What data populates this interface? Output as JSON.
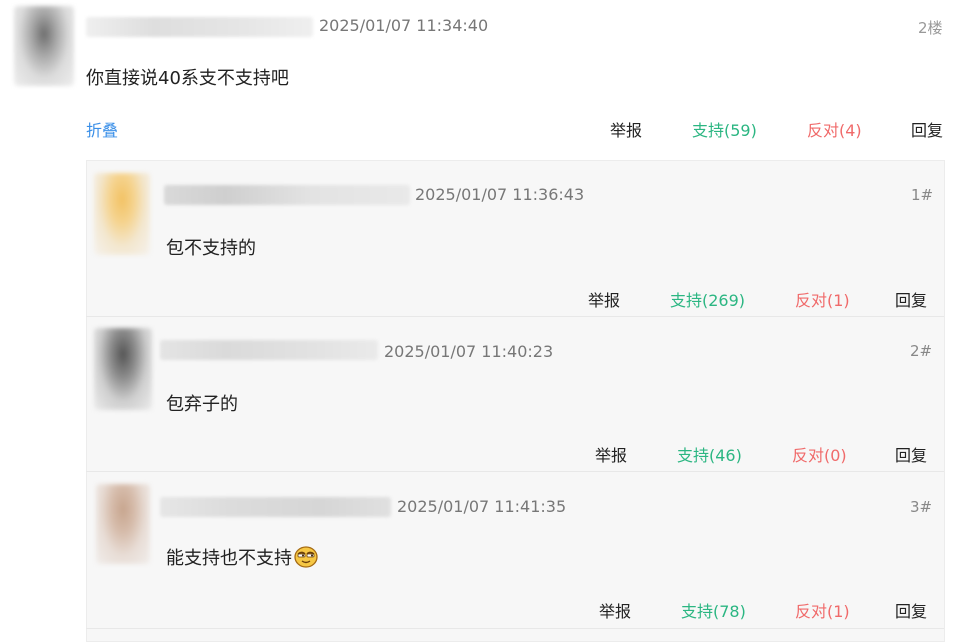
{
  "main_comment": {
    "time": "2025/01/07 11:34:40",
    "floor": "2楼",
    "content": "你直接说40系支不支持吧",
    "fold_label": "折叠",
    "report_label": "举报",
    "support_label": "支持(59)",
    "oppose_label": "反对(4)",
    "reply_label": "回复"
  },
  "replies": [
    {
      "time": "2025/01/07 11:36:43",
      "floor": "1#",
      "content": "包不支持的",
      "report_label": "举报",
      "support_label": "支持(269)",
      "oppose_label": "反对(1)",
      "reply_label": "回复"
    },
    {
      "time": "2025/01/07 11:40:23",
      "floor": "2#",
      "content": "包弃子的",
      "report_label": "举报",
      "support_label": "支持(46)",
      "oppose_label": "反对(0)",
      "reply_label": "回复"
    },
    {
      "time": "2025/01/07 11:41:35",
      "floor": "3#",
      "content": "能支持也不支持",
      "report_label": "举报",
      "support_label": "支持(78)",
      "oppose_label": "反对(1)",
      "reply_label": "回复",
      "emoji": "sly-smile-emoji-icon"
    }
  ],
  "colors": {
    "support": "#2bb682",
    "oppose": "#f06a6a",
    "fold": "#3a8fe8"
  }
}
